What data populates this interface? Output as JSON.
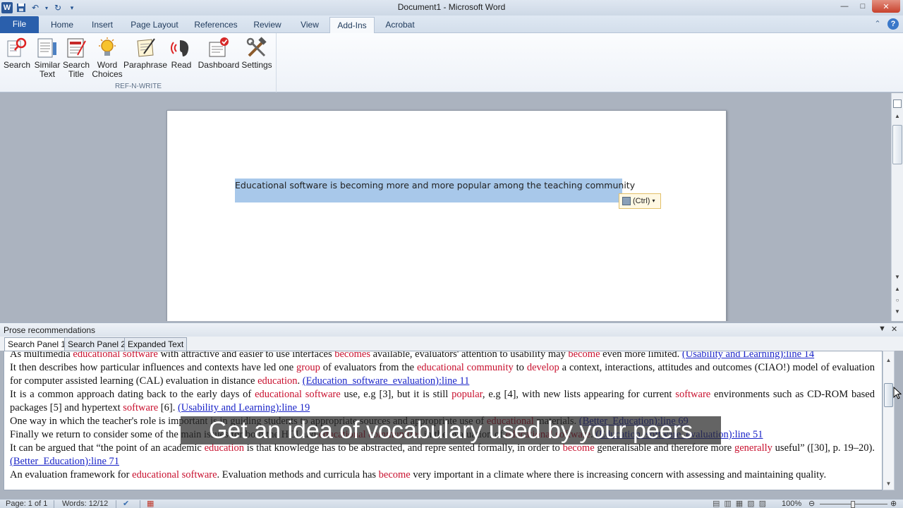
{
  "window": {
    "title": "Document1  -  Microsoft Word",
    "app_icon": "W",
    "controls": [
      "minimize",
      "maximize",
      "close"
    ]
  },
  "ribbon_tabs": [
    "File",
    "Home",
    "Insert",
    "Page Layout",
    "References",
    "Review",
    "View",
    "Add-Ins",
    "Acrobat"
  ],
  "active_tab": "Add-Ins",
  "ribbon_group": {
    "label": "REF-N-WRITE",
    "buttons": [
      {
        "label": "Search",
        "icon": "search-icon"
      },
      {
        "label": "Similar\nText",
        "icon": "similar-text-icon"
      },
      {
        "label": "Search\nTitle",
        "icon": "search-title-icon"
      },
      {
        "label": "Word\nChoices",
        "icon": "bulb-icon"
      },
      {
        "label": "Paraphrase",
        "icon": "paraphrase-icon"
      },
      {
        "label": "Read",
        "icon": "read-aloud-icon"
      },
      {
        "label": "Dashboard",
        "icon": "dashboard-icon"
      },
      {
        "label": "Settings",
        "icon": "tools-icon"
      }
    ]
  },
  "document": {
    "text": "Educational software is becoming more and more popular among the teaching community",
    "paste_options": "(Ctrl)"
  },
  "panel": {
    "title": "Prose recommendations",
    "tabs": [
      "Search Panel 1",
      "Search Panel 2",
      "Expanded Text"
    ],
    "active_tab": "Search Panel 1",
    "results": [
      [
        {
          "t": "As multimedia "
        },
        {
          "t": "educational software",
          "k": 1
        },
        {
          "t": " with attractive and easier to use interfaces "
        },
        {
          "t": "becomes",
          "k": 1
        },
        {
          "t": " available,  evaluators' attention to usability may "
        },
        {
          "t": "become",
          "k": 1
        },
        {
          "t": " even more limited. "
        },
        {
          "t": "(Usability and Learning):line 14",
          "l": 1
        }
      ],
      [
        {
          "t": "It then describes how particular influences and  contexts have led one "
        },
        {
          "t": "group",
          "k": 1
        },
        {
          "t": " of evaluators from the "
        },
        {
          "t": "educational community",
          "k": 1
        },
        {
          "t": " to "
        },
        {
          "t": "develop",
          "k": 1
        },
        {
          "t": " a context,  interactions, attitudes and outcomes (CIAO!) model of evaluation for computer assisted learning  (CAL) evaluation in distance "
        },
        {
          "t": "education",
          "k": 1
        },
        {
          "t": ". "
        },
        {
          "t": "(Education_software_evaluation):line 11",
          "l": 1
        }
      ],
      [
        {
          "t": "It is a common  approach dating back to the early days of "
        },
        {
          "t": "educational software",
          "k": 1
        },
        {
          "t": " use, e.g  [3], but it is still "
        },
        {
          "t": "popular",
          "k": 1
        },
        {
          "t": ",  e.g  [4], with new lists appearing for current "
        },
        {
          "t": "software",
          "k": 1
        },
        {
          "t": " environments such as CD-ROM based  packages  [5] and hypertext  "
        },
        {
          "t": "software",
          "k": 1
        },
        {
          "t": "  [6]. "
        },
        {
          "t": "(Usability and Learning):line 19",
          "l": 1
        }
      ],
      [
        {
          "t": "One way in which the teacher's role is important is in guiding students to appropriate sources and appropriate use of "
        },
        {
          "t": "educational",
          "k": 1
        },
        {
          "t": " materials. "
        },
        {
          "t": "(Better_Education):line 69",
          "l": 1
        }
      ],
      [
        {
          "t": "Finally we return to consider some of the main issues for both the  HCI and "
        },
        {
          "t": "educational communities",
          "k": 1
        },
        {
          "t": " in the evaluation of "
        },
        {
          "t": "educational software",
          "k": 1
        },
        {
          "t": ". "
        },
        {
          "t": "(Education_software_evaluation):line 51",
          "l": 1
        }
      ],
      [
        {
          "t": "It can be argued that  “the point of an academic "
        },
        {
          "t": "education",
          "k": 1
        },
        {
          "t": " is that knowledge has to be abstracted, and repre sented formally, in order to "
        },
        {
          "t": "become",
          "k": 1
        },
        {
          "t": " generalisable and therefore more "
        },
        {
          "t": "generally",
          "k": 1
        },
        {
          "t": " useful”  ([30], p. 19–20). "
        },
        {
          "t": "(Better_Education):line 71",
          "l": 1
        }
      ],
      [
        {
          "t": "An evaluation framework for "
        },
        {
          "t": "educational software",
          "k": 1
        },
        {
          "t": ". Evaluation methods and curricula has "
        },
        {
          "t": "become",
          "k": 1
        },
        {
          "t": " very important in a climate where there is  increasing concern with assessing and maintaining quality."
        }
      ]
    ]
  },
  "caption": "Get an idea of vocabulary used by your peers",
  "statusbar": {
    "page": "Page: 1 of 1",
    "words": "Words: 12/12",
    "zoom": "100%"
  }
}
